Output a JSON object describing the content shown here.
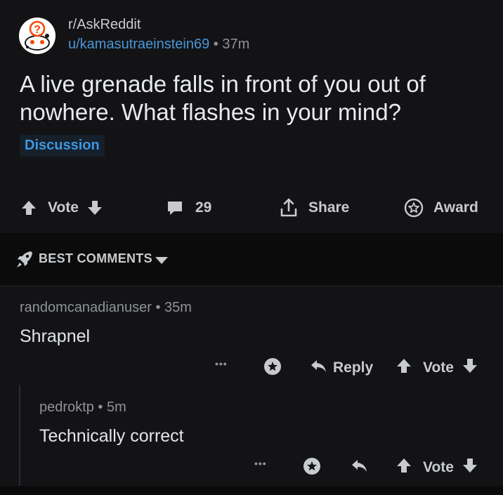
{
  "post": {
    "subreddit": "r/AskReddit",
    "author": "u/kamasutraeinstein69",
    "separator": "•",
    "time": "37m",
    "title": "A live grenade falls in front of you out of nowhere. What flashes in your mind?",
    "flair": "Discussion",
    "actions": {
      "vote_label": "Vote",
      "comment_count": "29",
      "share_label": "Share",
      "award_label": "Award"
    }
  },
  "sort": {
    "label": "BEST COMMENTS"
  },
  "comments": [
    {
      "author": "randomcanadianuser",
      "separator": "•",
      "time": "35m",
      "body": "Shrapnel",
      "more": "•••",
      "reply_label": "Reply",
      "vote_label": "Vote"
    },
    {
      "author": "pedroktp",
      "separator": "•",
      "time": "5m",
      "body": "Technically correct",
      "more": "•••",
      "vote_label": "Vote"
    }
  ],
  "icons": {
    "subreddit": "askreddit-snoo-icon",
    "upvote": "arrow-up-icon",
    "downvote": "arrow-down-icon",
    "comment": "comment-bubble-icon",
    "share": "share-icon",
    "award": "award-star-icon",
    "sort": "rocket-icon",
    "dropdown": "caret-down-icon",
    "reply": "reply-arrow-icon"
  },
  "colors": {
    "background": "#0b0b0b",
    "card": "#131316",
    "link_blue": "#4a96d6",
    "flair_blue": "#3d97e0",
    "text_primary": "#e8eaeb",
    "text_secondary": "#8f9296"
  }
}
